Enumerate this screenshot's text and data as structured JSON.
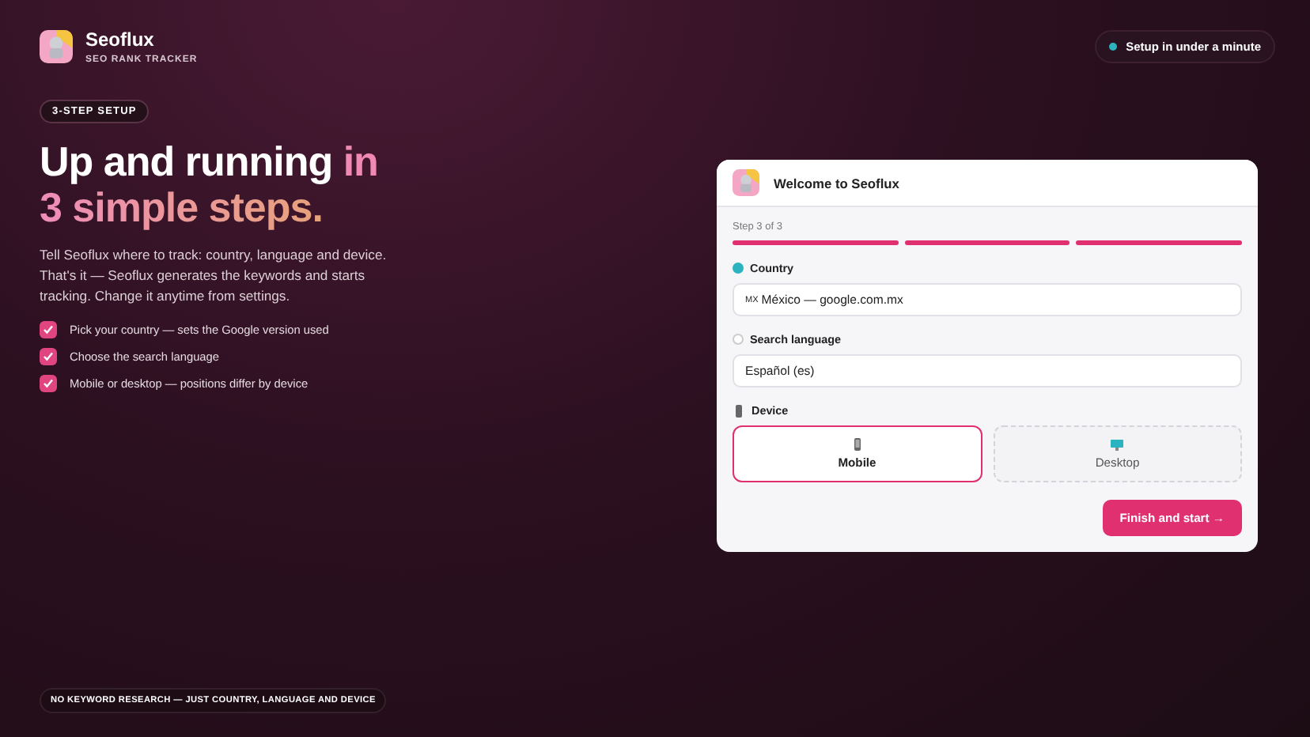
{
  "brand": {
    "name": "Seoflux",
    "tagline": "SEO RANK TRACKER"
  },
  "status_pill": {
    "text": "Setup in under a minute"
  },
  "hero": {
    "badge": "3-STEP SETUP",
    "headline": [
      {
        "text": "Up and running ",
        "kind": "plain"
      },
      {
        "text": "in",
        "kind": "accent"
      },
      {
        "text": "3 simple steps.",
        "kind": "gradient"
      }
    ],
    "description": "Tell Seoflux where to track: country, language and device. That's it — Seoflux generates the keywords and starts tracking. Change it anytime from settings.",
    "checklist": [
      {
        "text": "Pick your country — sets the Google version used",
        "checked": true
      },
      {
        "text": "Choose the search language",
        "checked": true
      },
      {
        "text": "Mobile or desktop — positions differ by device",
        "checked": true
      }
    ]
  },
  "footer_pill": "NO KEYWORD RESEARCH — JUST COUNTRY, LANGUAGE AND DEVICE",
  "dialog": {
    "title": "Welcome to Seoflux",
    "step_label": "Step 3 of 3",
    "progress": [
      {
        "completed": true
      },
      {
        "completed": true
      },
      {
        "completed": true
      }
    ],
    "fields": [
      {
        "label": "Country",
        "done": true,
        "prefix": "MX",
        "value": "México — google.com.mx"
      },
      {
        "label": "Search language",
        "done": false,
        "value": "Español (es)"
      }
    ],
    "device": {
      "label": "Device",
      "options": [
        {
          "label": "Mobile",
          "kind": "mobile",
          "selected": true
        },
        {
          "label": "Desktop",
          "kind": "desktop",
          "selected": false
        }
      ]
    },
    "primary_button": "Finish and start →"
  }
}
